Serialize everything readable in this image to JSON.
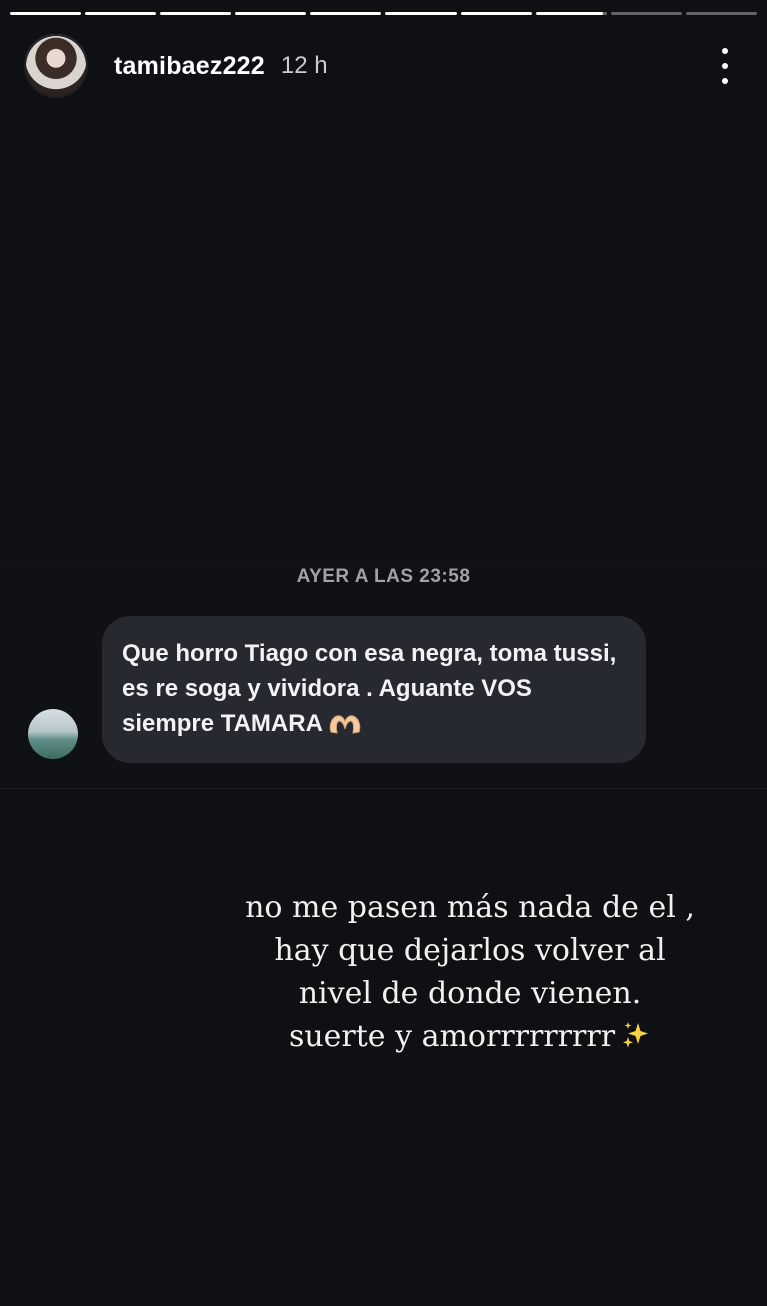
{
  "story": {
    "progress": {
      "segments": 10,
      "completed": 7,
      "current_fraction": 0.95
    },
    "header": {
      "username": "tamibaez222",
      "time": "12 h"
    },
    "shared_message": {
      "timestamp": "AYER A LAS 23:58",
      "text": "Que horro Tiago con esa negra, toma tussi, es re soga y vividora . Aguante VOS siempre TAMARA",
      "emoji": "heart-hands-emoji"
    },
    "caption": {
      "lines": [
        "no me pasen más nada de el ,",
        "hay que dejarlos volver al",
        "nivel de donde vienen.",
        "suerte y amorrrrrrrrr"
      ],
      "emoji": "sparkles-emoji"
    }
  },
  "colors": {
    "background": "#0e1014",
    "bubble": "#26292f",
    "timestamp": "#9ea3aa"
  }
}
